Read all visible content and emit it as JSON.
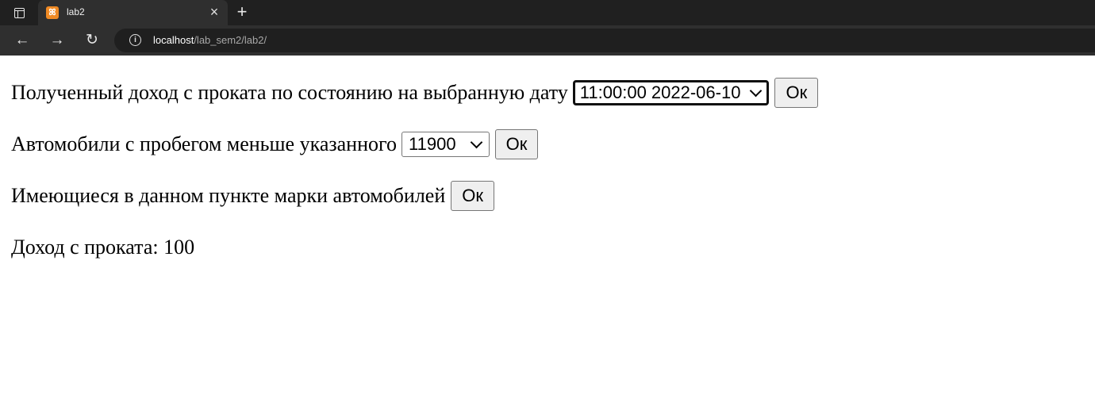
{
  "browser": {
    "tab_title": "lab2",
    "url_host": "localhost",
    "url_path": "/lab_sem2/lab2/"
  },
  "icons": {
    "tab_actions": "tab-actions-icon",
    "favicon": "xampp-favicon",
    "close": "close-icon",
    "new_tab": "plus-icon",
    "back": "back-arrow-icon",
    "forward": "forward-arrow-icon",
    "reload": "reload-icon",
    "info": "info-icon"
  },
  "page": {
    "income_form": {
      "label": "Полученный доход с проката по состоянию на выбранную дату",
      "selected_date": "11:00:00 2022-06-10",
      "button": "Ок"
    },
    "mileage_form": {
      "label": "Автомобили с пробегом меньше указанного",
      "selected_mileage": "11900",
      "button": "Ок"
    },
    "brands_form": {
      "label": "Имеющиеся в данном пункте марки автомобилей",
      "button": "Ок"
    },
    "result": "Доход с проката: 100"
  },
  "colors": {
    "titlebar": "#202020",
    "toolbar": "#2f2f2f",
    "favicon": "#f08a24"
  }
}
